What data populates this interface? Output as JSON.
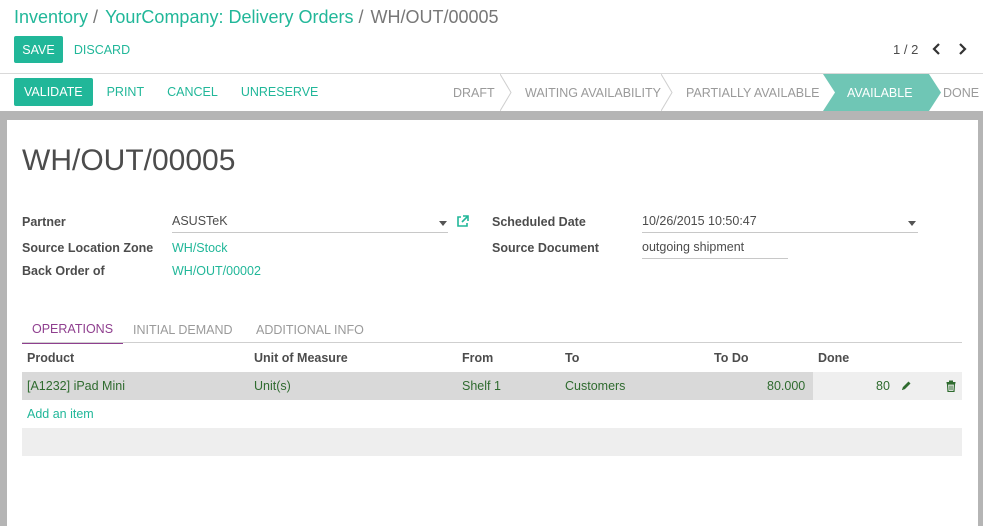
{
  "breadcrumb": {
    "root": "Inventory",
    "parent": "YourCompany: Delivery Orders",
    "current": "WH/OUT/00005"
  },
  "buttons": {
    "save": "SAVE",
    "discard": "DISCARD"
  },
  "pager": {
    "value": "1 / 2"
  },
  "actions": {
    "validate": "VALIDATE",
    "print": "PRINT",
    "cancel": "CANCEL",
    "unreserve": "UNRESERVE"
  },
  "stages": [
    {
      "label": "DRAFT",
      "active": false
    },
    {
      "label": "WAITING AVAILABILITY",
      "active": false
    },
    {
      "label": "PARTIALLY AVAILABLE",
      "active": false
    },
    {
      "label": "AVAILABLE",
      "active": true
    },
    {
      "label": "DONE",
      "active": false
    }
  ],
  "record": {
    "title": "WH/OUT/00005",
    "partner_label": "Partner",
    "partner_value": "ASUSTeK",
    "source_location_label": "Source Location Zone",
    "source_location_value": "WH/Stock",
    "back_order_label": "Back Order of",
    "back_order_value": "WH/OUT/00002",
    "scheduled_date_label": "Scheduled Date",
    "scheduled_date_value": "10/26/2015 10:50:47",
    "source_document_label": "Source Document",
    "source_document_value": "outgoing shipment"
  },
  "tabs": [
    "OPERATIONS",
    "INITIAL DEMAND",
    "ADDITIONAL INFO"
  ],
  "table": {
    "headers": [
      "Product",
      "Unit of Measure",
      "From",
      "To",
      "To Do",
      "Done"
    ],
    "rows": [
      {
        "product": "[A1232] iPad Mini",
        "uom": "Unit(s)",
        "from": "Shelf 1",
        "to": "Customers",
        "todo": "80.000",
        "done": "80"
      }
    ],
    "add_item": "Add an item"
  },
  "colors": {
    "accent": "#21b799",
    "active_tab": "#8f3f8f",
    "active_stage": "#6fc6b5",
    "row_text": "#2f6b2f"
  },
  "icons": {
    "external": "external-link-icon",
    "edit": "pencil-icon",
    "delete": "trash-icon"
  }
}
